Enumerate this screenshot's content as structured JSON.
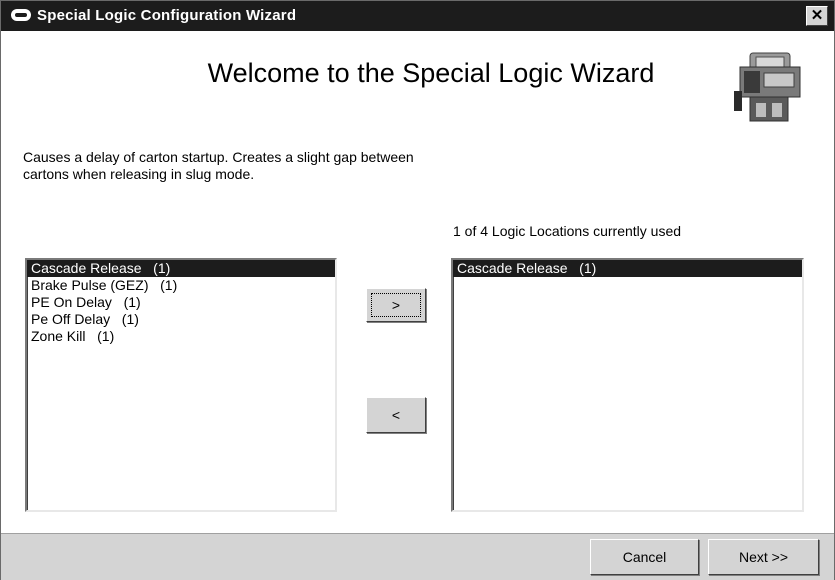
{
  "window": {
    "title": "Special Logic Configuration Wizard",
    "close_label": "✕"
  },
  "main": {
    "heading": "Welcome to the Special Logic Wizard",
    "description": "Causes a delay of carton startup. Creates a slight gap between cartons when releasing in slug mode.",
    "usage_text": "1 of 4 Logic Locations currently used"
  },
  "available_list": {
    "items": [
      {
        "label": "Cascade Release   (1)",
        "selected": true
      },
      {
        "label": "Brake Pulse (GEZ)   (1)",
        "selected": false
      },
      {
        "label": "PE On Delay   (1)",
        "selected": false
      },
      {
        "label": "Pe Off Delay   (1)",
        "selected": false
      },
      {
        "label": "Zone Kill   (1)",
        "selected": false
      }
    ]
  },
  "used_list": {
    "items": [
      {
        "label": "Cascade Release   (1)",
        "selected": true
      }
    ]
  },
  "buttons": {
    "move_right": ">",
    "move_left": "<",
    "cancel": "Cancel",
    "next": "Next >>"
  },
  "icons": {
    "app": "app-logo-icon",
    "wizard": "controller-device-icon"
  }
}
